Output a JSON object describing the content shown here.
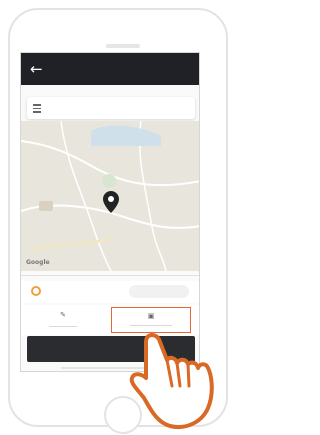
{
  "app": {
    "title": "",
    "back_icon": "back-arrow-icon"
  },
  "search": {
    "address": "",
    "menu_icon": "menu-icon"
  },
  "map": {
    "provider": "Google",
    "labels": []
  },
  "selector": {
    "label": ""
  },
  "options": {
    "left_icon": "edit-icon",
    "right_icon": "car-icon"
  },
  "action": {
    "confirm_label": ""
  },
  "colors": {
    "header_bg": "#1f2126",
    "accent": "#e8663b",
    "cta_bg": "#2b2c30"
  }
}
